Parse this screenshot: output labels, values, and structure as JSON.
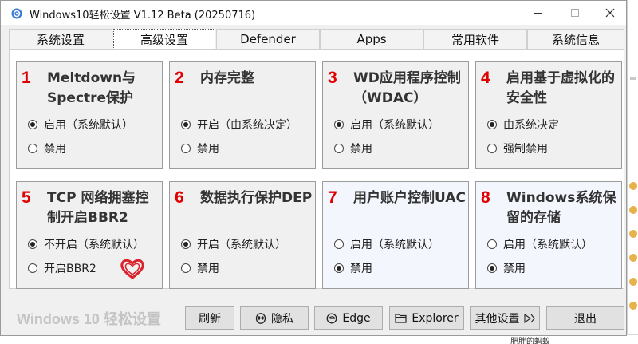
{
  "window": {
    "title": "Windows10轻松设置 V1.12 Beta (20250716)"
  },
  "tabs": [
    {
      "label": "系统设置",
      "active": false
    },
    {
      "label": "高级设置",
      "active": true
    },
    {
      "label": "Defender",
      "active": false
    },
    {
      "label": "Apps",
      "active": false
    },
    {
      "label": "常用软件",
      "active": false
    },
    {
      "label": "系统信息",
      "active": false
    }
  ],
  "cards": [
    {
      "num": "1",
      "title": "Meltdown与Spectre保护",
      "options": [
        {
          "label": "启用（系统默认）",
          "checked": true
        },
        {
          "label": "禁用",
          "checked": false
        }
      ]
    },
    {
      "num": "2",
      "title": "内存完整",
      "options": [
        {
          "label": "开启（由系统决定）",
          "checked": true
        },
        {
          "label": "禁用",
          "checked": false
        }
      ]
    },
    {
      "num": "3",
      "title": "WD应用程序控制（WDAC）",
      "options": [
        {
          "label": "启用（系统默认）",
          "checked": true
        },
        {
          "label": "禁用",
          "checked": false
        }
      ]
    },
    {
      "num": "4",
      "title": "启用基于虚拟化的安全性",
      "options": [
        {
          "label": "由系统决定",
          "checked": true
        },
        {
          "label": "强制禁用",
          "checked": false
        }
      ]
    },
    {
      "num": "5",
      "title": "TCP 网络拥塞控制开启BBR2",
      "options": [
        {
          "label": "不开启（系统默认）",
          "checked": true
        },
        {
          "label": "开启BBR2",
          "checked": false
        }
      ]
    },
    {
      "num": "6",
      "title": "数据执行保护DEP",
      "options": [
        {
          "label": "开启（系统默认）",
          "checked": true
        },
        {
          "label": "禁用",
          "checked": false
        }
      ]
    },
    {
      "num": "7",
      "title": "用户账户控制UAC",
      "options": [
        {
          "label": "启用（系统默认）",
          "checked": false
        },
        {
          "label": "禁用",
          "checked": true
        }
      ]
    },
    {
      "num": "8",
      "title": "Windows系统保留的存储",
      "options": [
        {
          "label": "启用（系统默认）",
          "checked": false
        },
        {
          "label": "禁用",
          "checked": true
        }
      ]
    }
  ],
  "bottom": {
    "brand": "Windows 10 轻松设置",
    "refresh": "刷新",
    "privacy": "隐私",
    "edge": "Edge",
    "explorer": "Explorer",
    "other": "其他设置",
    "exit": "退出"
  },
  "background": {
    "bottom_text": "肥胖的蚂蚁"
  },
  "colors": {
    "accent_number": "#e00000",
    "heart": "#d9232d"
  }
}
